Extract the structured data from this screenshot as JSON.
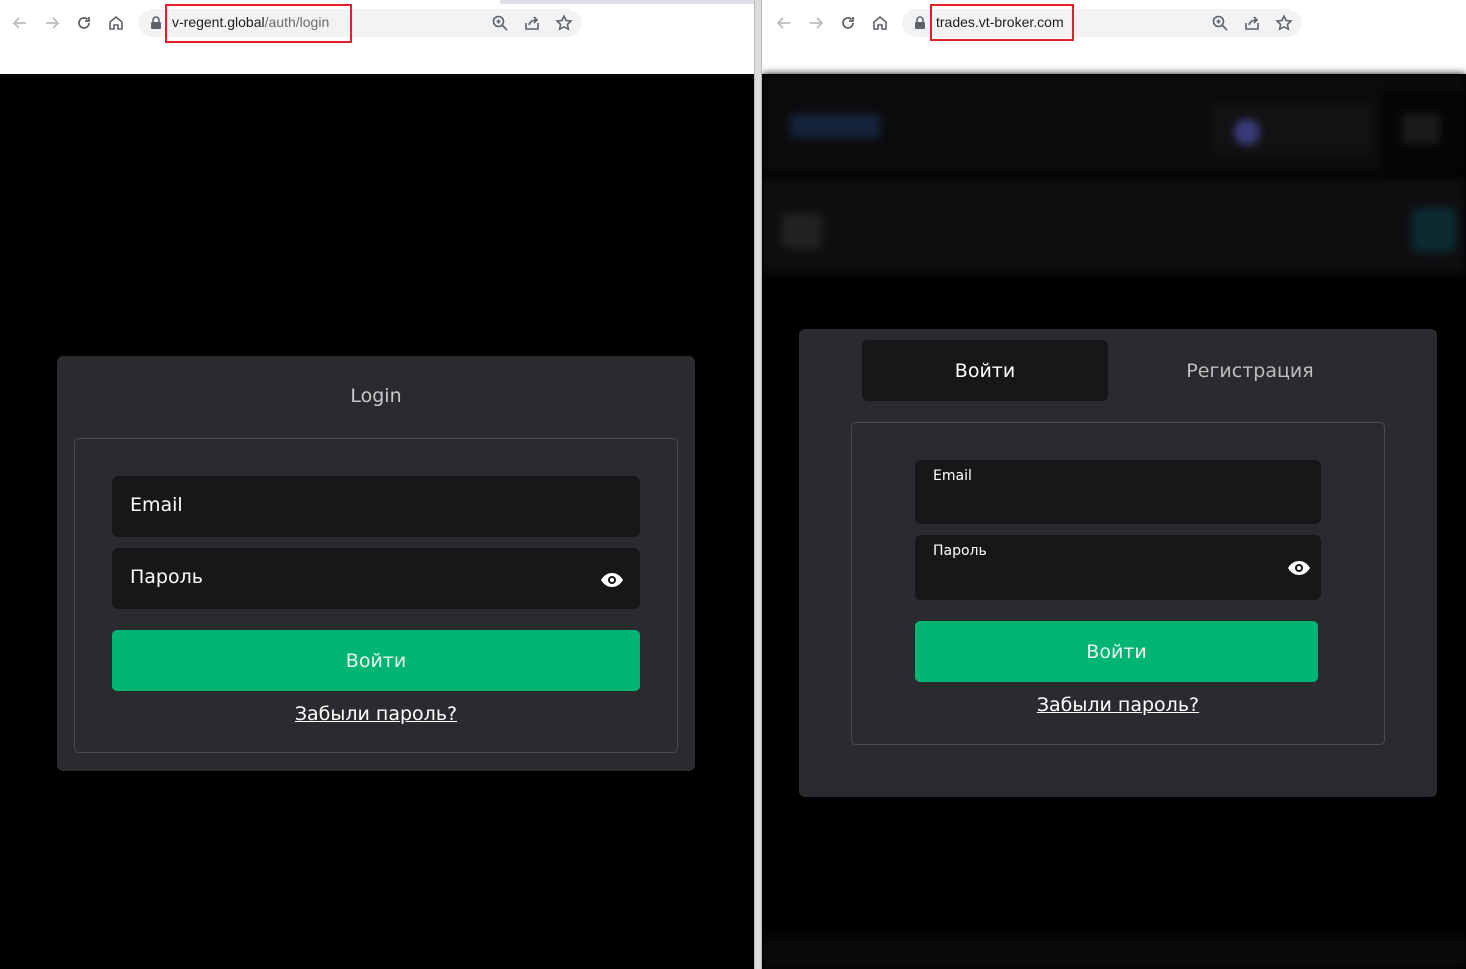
{
  "left_window": {
    "url_domain": "v-regent.global",
    "url_path": "/auth/login",
    "login_card": {
      "title": "Login",
      "email_label": "Email",
      "password_label": "Пароль",
      "submit_label": "Войти",
      "forgot_label": "Забыли пароль?"
    }
  },
  "right_window": {
    "url_domain": "trades.vt-broker.com",
    "login_card": {
      "tab_login": "Войти",
      "tab_register": "Регистрация",
      "email_label": "Email",
      "password_label": "Пароль",
      "submit_label": "Войти",
      "forgot_label": "Забыли пароль?"
    }
  },
  "colors": {
    "page_background": "#000000",
    "card_background": "#2a2b2f",
    "field_background": "#17171a",
    "button_green": "#00b574",
    "url_highlight": "#e0202a"
  },
  "icons": [
    "back-arrow-icon",
    "forward-arrow-icon",
    "reload-icon",
    "home-icon",
    "lock-icon",
    "zoom-icon",
    "share-icon",
    "star-icon",
    "eye-icon"
  ]
}
